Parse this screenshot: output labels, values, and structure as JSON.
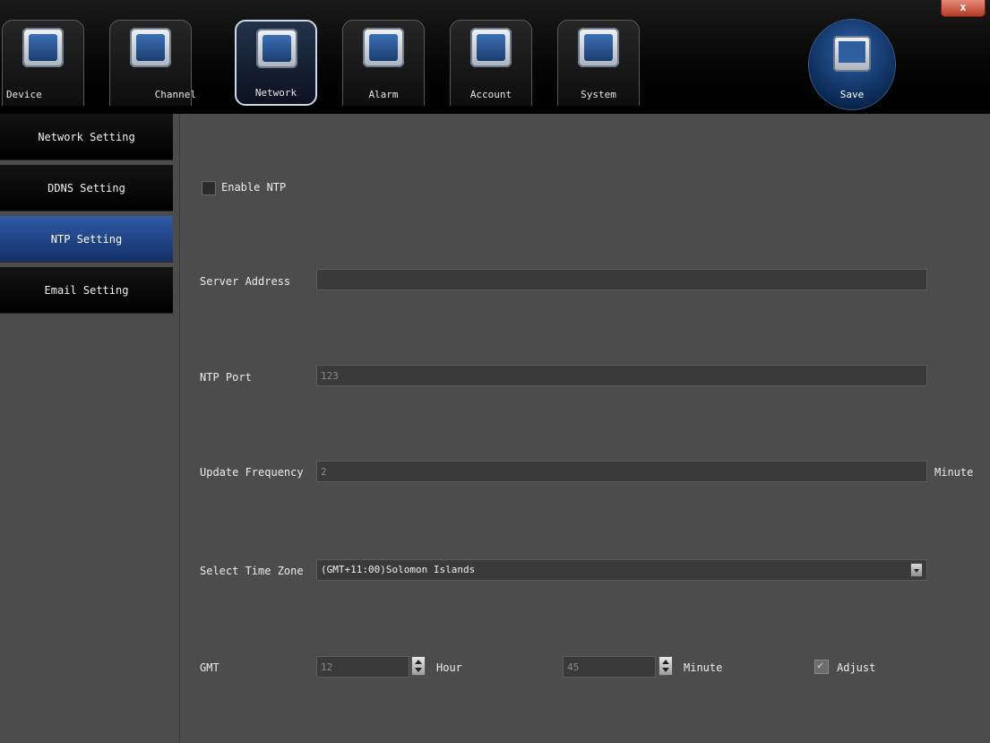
{
  "toolbar": {
    "items": [
      {
        "label": "Device",
        "icon": "device-icon"
      },
      {
        "label": "Channel",
        "icon": "channel-icon"
      },
      {
        "label": "Network",
        "icon": "network-icon",
        "active": true
      },
      {
        "label": "Alarm",
        "icon": "alarm-icon"
      },
      {
        "label": "Account",
        "icon": "account-icon"
      },
      {
        "label": "System",
        "icon": "system-icon"
      }
    ],
    "save_label": "Save",
    "close_label": "x"
  },
  "sidebar": {
    "items": [
      {
        "label": "Network Setting"
      },
      {
        "label": "DDNS Setting"
      },
      {
        "label": "NTP Setting",
        "active": true
      },
      {
        "label": "Email Setting"
      }
    ]
  },
  "ntp": {
    "enable_label": "Enable NTP",
    "enable_checked": false,
    "server_address_label": "Server Address",
    "server_address_value": "",
    "ntp_port_label": "NTP Port",
    "ntp_port_value": "123",
    "update_frequency_label": "Update Frequency",
    "update_frequency_value": "2",
    "update_frequency_unit": "Minute",
    "time_zone_label": "Select Time Zone",
    "time_zone_value": "(GMT+11:00)Solomon Islands",
    "gmt_label": "GMT",
    "gmt_hour_value": "12",
    "hour_unit": "Hour",
    "gmt_minute_value": "45",
    "minute_unit": "Minute",
    "adjust_label": "Adjust",
    "adjust_checked": true
  },
  "colors": {
    "active_tab": "#14306a",
    "background": "#4c4c4c",
    "toolbar": "#050505"
  }
}
